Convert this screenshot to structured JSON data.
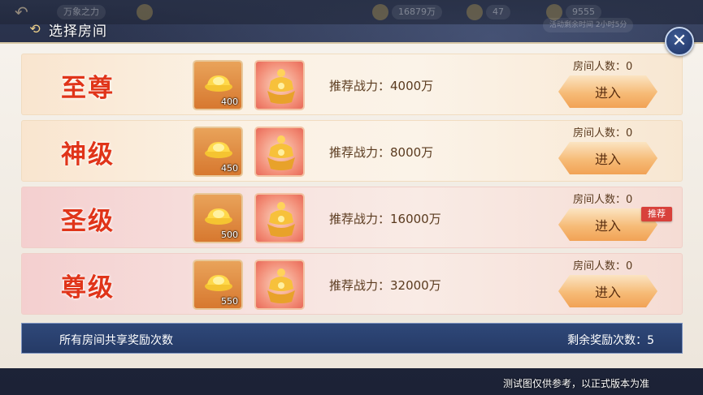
{
  "header": {
    "title": "选择房间"
  },
  "topbar": {
    "ghost_texts": [
      "万象之力",
      "16879万",
      "47",
      "9555",
      "活动剩余时间 2小时5分"
    ]
  },
  "rooms": [
    {
      "title": "至尊",
      "ingot_count": "400",
      "power_label": "推荐战力：4000万",
      "count_label": "房间人数：0",
      "enter_label": "进入",
      "highlight": false
    },
    {
      "title": "神级",
      "ingot_count": "450",
      "power_label": "推荐战力：8000万",
      "count_label": "房间人数：0",
      "enter_label": "进入",
      "highlight": false
    },
    {
      "title": "圣级",
      "ingot_count": "500",
      "power_label": "推荐战力：16000万",
      "count_label": "房间人数：0",
      "enter_label": "进入",
      "highlight": true,
      "badge": "推荐"
    },
    {
      "title": "尊级",
      "ingot_count": "550",
      "power_label": "推荐战力：32000万",
      "count_label": "房间人数：0",
      "enter_label": "进入",
      "highlight": true
    }
  ],
  "footer": {
    "left_text": "所有房间共享奖励次数",
    "right_text": "剩余奖励次数：5"
  },
  "note": "测试图仅供参考，以正式版本为准",
  "icons": {
    "close": "close-icon",
    "header": "return-icon",
    "ingot": "gold-ingot-icon",
    "gift": "golden-treasure-icon"
  },
  "colors": {
    "title_red": "#e03419",
    "footer_blue": "#2f4879",
    "button_orange": "#f6bb77",
    "badge_red": "#d8413b"
  }
}
